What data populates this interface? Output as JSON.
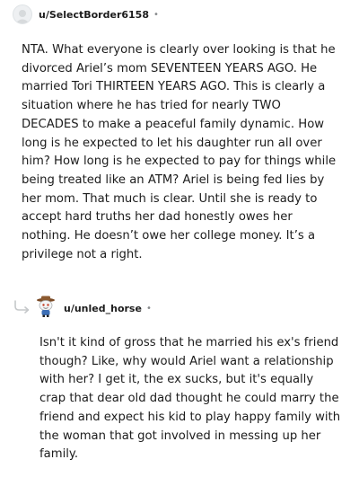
{
  "top_comment": {
    "username": "u/SelectBorder6158",
    "separator": "•",
    "avatar_icon": "generic-user-avatar-icon",
    "text": "NTA. What everyone is clearly over looking is that he divorced Ariel’s mom SEVENTEEN YEARS AGO. He married Tori THIRTEEN YEARS AGO. This is clearly a situation where he has tried for nearly TWO DECADES to make a peaceful family dynamic. How long is he expected to let his daughter run all over him? How long is he expected to pay for things while being treated like an ATM? Ariel is being fed lies by her mom. That much is clear. Until she is ready to accept hard truths her dad honestly owes her nothing. He doesn’t owe her college money. It’s a privilege not a right."
  },
  "reply": {
    "thread_icon": "reply-thread-arrow-icon",
    "avatar_icon": "horse-snoo-avatar-icon",
    "username": "u/unled_horse",
    "separator": "•",
    "text": "Isn't it kind of gross that he married his ex's friend though? Like, why would Ariel want a relationship with her? I get it, the ex sucks, but it's equally crap that dear old dad thought he could marry the friend and expect his kid to play happy family with the woman that got involved in messing up her family."
  }
}
